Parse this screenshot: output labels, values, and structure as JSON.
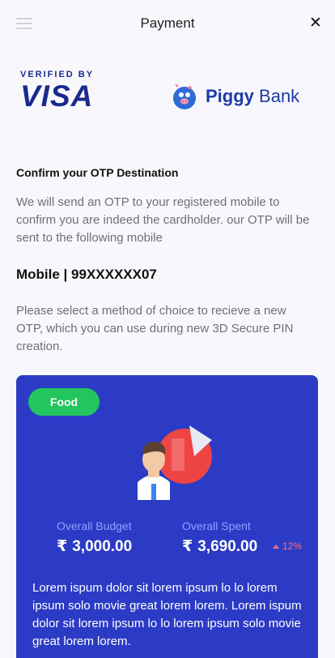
{
  "header": {
    "title": "Payment",
    "close_icon": "close-icon",
    "menu_icon": "menu-icon"
  },
  "logos": {
    "visa_top": "VERIFIED BY",
    "visa_word": "VISA",
    "piggy_word1": "Piggy",
    "piggy_word2": "Bank"
  },
  "otp": {
    "section_title": "Confirm your OTP Destination",
    "description": "We will send an OTP to your registered mobile to confirm you are indeed the cardholder. our OTP will be sent to the following mobile",
    "mobile": "Mobile | 99XXXXXX07",
    "instruction": "Please select a method of choice to recieve a new OTP, which you can use during new 3D Secure PIN creation."
  },
  "card": {
    "chip": "Food",
    "budget_label": "Overall Budget",
    "budget_currency": "₹",
    "budget_value": "3,000.00",
    "spent_label": "Overall Spent",
    "spent_currency": "₹",
    "spent_value": "3,690.00",
    "trend": "12%",
    "text": "Lorem ispum dolor sit lorem ipsum lo lo lorem ipsum solo movie great lorem lorem. Lorem ispum dolor sit lorem ipsum lo lo lorem ipsum solo movie great lorem lorem."
  },
  "colors": {
    "brand_blue": "#2b3bc5",
    "chip_green": "#22c55e",
    "visa_blue": "#1a2a8c",
    "trend_red": "#ff6e7f"
  }
}
